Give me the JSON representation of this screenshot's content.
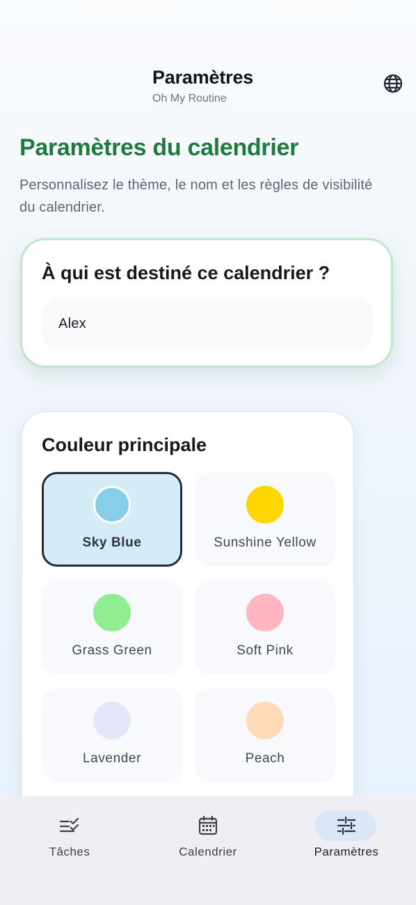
{
  "header": {
    "title": "Paramètres",
    "subtitle": "Oh My Routine",
    "language_icon": "globe-icon"
  },
  "page": {
    "heading": "Paramètres du calendrier",
    "description": "Personnalisez le thème, le nom et les règles de visibilité du calendrier."
  },
  "name_card": {
    "title": "À qui est destiné ce calendrier ?",
    "input_value": "Alex"
  },
  "color_card": {
    "title": "Couleur principale",
    "selected": "Sky Blue",
    "options": [
      {
        "label": "Sky Blue",
        "color": "#87ceeb"
      },
      {
        "label": "Sunshine Yellow",
        "color": "#ffd700"
      },
      {
        "label": "Grass Green",
        "color": "#90ee90"
      },
      {
        "label": "Soft Pink",
        "color": "#ffb6c1"
      },
      {
        "label": "Lavender",
        "color": "#e6e6fa"
      },
      {
        "label": "Peach",
        "color": "#ffdab9"
      }
    ]
  },
  "nav": {
    "items": [
      {
        "label": "Tâches",
        "icon": "checklist-icon"
      },
      {
        "label": "Calendrier",
        "icon": "calendar-icon"
      },
      {
        "label": "Paramètres",
        "icon": "sliders-icon",
        "active": true
      }
    ]
  },
  "colors": {
    "heading_green": "#1f7a3e",
    "selected_border": "#1f2a3a",
    "selected_bg": "#d5ecf7",
    "nav_active_pill": "#d9e7f7"
  }
}
